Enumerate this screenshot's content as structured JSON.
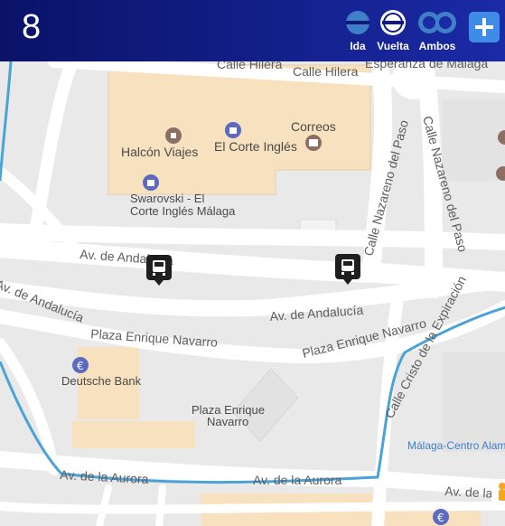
{
  "header": {
    "line_number": "8",
    "directions": [
      {
        "label": "Ida",
        "selected": false
      },
      {
        "label": "Vuelta",
        "selected": true
      },
      {
        "label": "Ambos",
        "selected": false
      }
    ],
    "add_icon": "plus-icon"
  },
  "map": {
    "streets": {
      "hilera_1": "Calle Hilera",
      "hilera_2": "Calle Hilera",
      "esperanza": "Esperanza de Málaga",
      "andalucia_1": "Av. de Andalucía",
      "andalucia_2": "Av. de Andalucía",
      "andalucia_3": "Av. de Andalucía",
      "navarro_1": "Plaza Enrique Navarro",
      "navarro_2": "Plaza Enrique Navarro",
      "nazareno_1": "Calle Nazareno del Paso",
      "nazareno_2": "Calle Nazareno del Paso",
      "cristo": "Calle Cristo de la Expiración",
      "aurora_1": "Av. de la Aurora",
      "aurora_2": "Av. de la Aurora",
      "aurora_3": "Av. de la Aur"
    },
    "places": {
      "halcon": "Halcón Viajes",
      "corte": "El Corte Inglés",
      "correos": "Correos",
      "swarovski_1": "Swarovski - El",
      "swarovski_2": "Corte Inglés Málaga",
      "deutsche": "Deutsche Bank",
      "plaza_1": "Plaza Enrique",
      "plaza_2": "Navarro",
      "centro": "Málaga-Centro Alam"
    },
    "route_color": "#4aa3d6",
    "bus_stop_icon": "bus-stop-icon"
  }
}
